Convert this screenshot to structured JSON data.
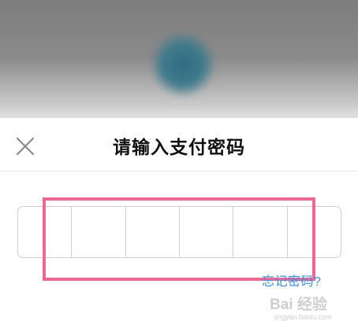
{
  "dialog": {
    "title": "请输入支付密码",
    "close_icon": "close-icon"
  },
  "password_input": {
    "digit_count": 6,
    "digits": [
      "",
      "",
      "",
      "",
      "",
      ""
    ]
  },
  "forgot_link": {
    "label": "忘记密码?"
  },
  "highlight": {
    "color": "#ec6796"
  },
  "watermark": {
    "main": "Bai 经验",
    "sub": "jingyan.baidu.com"
  },
  "colors": {
    "link": "#3a8fd6",
    "title": "#111111",
    "border": "#cfcfcf"
  }
}
